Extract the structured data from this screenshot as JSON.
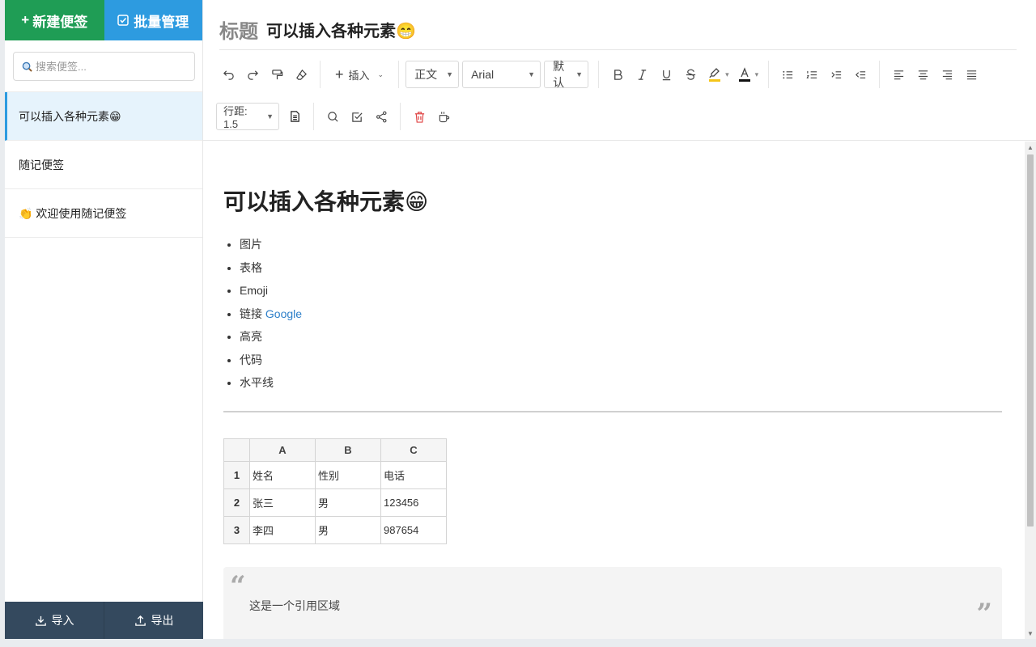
{
  "sidebar": {
    "new_note_label": "新建便签",
    "batch_manage_label": "批量管理",
    "search_placeholder": "搜索便签...",
    "notes": [
      {
        "title": "可以插入各种元素😁",
        "active": true
      },
      {
        "title": "随记便签",
        "active": false
      },
      {
        "title": "👏 欢迎使用随记便签",
        "active": false
      }
    ],
    "import_label": "导入",
    "export_label": "导出"
  },
  "editor": {
    "title_label": "标题",
    "title_value": "可以插入各种元素😁",
    "toolbar": {
      "insert_label": "插入",
      "paragraph_style": "正文",
      "font_family": "Arial",
      "font_size": "默认",
      "line_height": "行距: 1.5"
    },
    "content": {
      "heading": "可以插入各种元素😁",
      "list_items": [
        "图片",
        "表格",
        "Emoji",
        "链接",
        "高亮",
        "代码",
        "水平线"
      ],
      "link_text": "Google",
      "table": {
        "col_headers": [
          "A",
          "B",
          "C"
        ],
        "rows": [
          {
            "num": "1",
            "cells": [
              "姓名",
              "性别",
              "电话"
            ]
          },
          {
            "num": "2",
            "cells": [
              "张三",
              "男",
              "123456"
            ]
          },
          {
            "num": "3",
            "cells": [
              "李四",
              "男",
              "987654"
            ]
          }
        ]
      },
      "quote_text": "这是一个引用区域"
    }
  },
  "colors": {
    "new_button": "#1f9d55",
    "batch_button": "#2d9be0",
    "bottom_bar": "#34495e",
    "link": "#2d7fc9",
    "highlight_bar": "#f5c518"
  }
}
